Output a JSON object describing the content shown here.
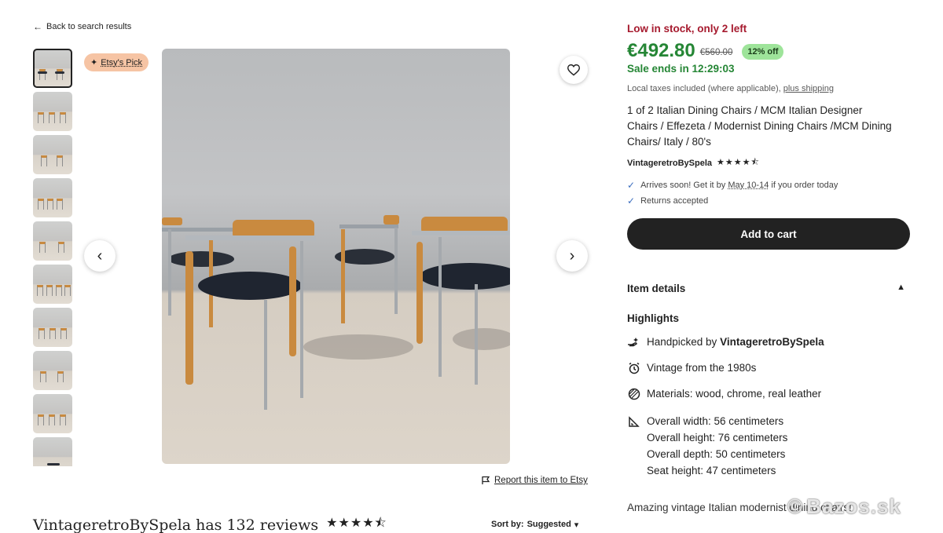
{
  "nav": {
    "back_label": "Back to search results"
  },
  "badge": {
    "etsy_pick": "Etsy's Pick"
  },
  "report": {
    "label": "Report this item to Etsy"
  },
  "reviews": {
    "title": "VintageretroBySpela has 132 reviews",
    "stars": "★★★★⯪",
    "sort_label": "Sort by:",
    "sort_value": "Suggested"
  },
  "product": {
    "stock": "Low in stock, only 2 left",
    "price": "€492.80",
    "old_price": "€560.00",
    "discount": "12% off",
    "sale_ends": "Sale ends in 12:29:03",
    "taxes_text": "Local taxes included (where applicable),",
    "taxes_link": "plus shipping",
    "title": "1 of 2 Italian Dining Chairs / MCM Italian Designer Chairs / Effezeta / Modernist Dining Chairs /MCM Dining Chairs/ Italy / 80's",
    "shop_name": "VintageretroBySpela",
    "shop_stars": "★★★★⯪",
    "arrives_pre": "Arrives soon! Get it by",
    "arrives_date": "May 10-14",
    "arrives_post": "if you order today",
    "returns": "Returns accepted",
    "add_to_cart": "Add to cart"
  },
  "details": {
    "header": "Item details",
    "highlights_title": "Highlights",
    "handpicked_pre": "Handpicked by",
    "handpicked_shop": "VintageretroBySpela",
    "vintage": "Vintage from the 1980s",
    "materials": "Materials: wood, chrome, real leather",
    "dims": [
      "Overall width: 56 centimeters",
      "Overall height: 76 centimeters",
      "Overall depth: 50 centimeters",
      "Seat height: 47 centimeters"
    ],
    "description": "Amazing vintage Italian modernist dining chairs!"
  },
  "watermark": "Bazos.sk",
  "colors": {
    "sale_green": "#258635",
    "stock_red": "#a61a2e",
    "discount_bg": "#9ee49a",
    "badge_bg": "#f6c4a4"
  }
}
